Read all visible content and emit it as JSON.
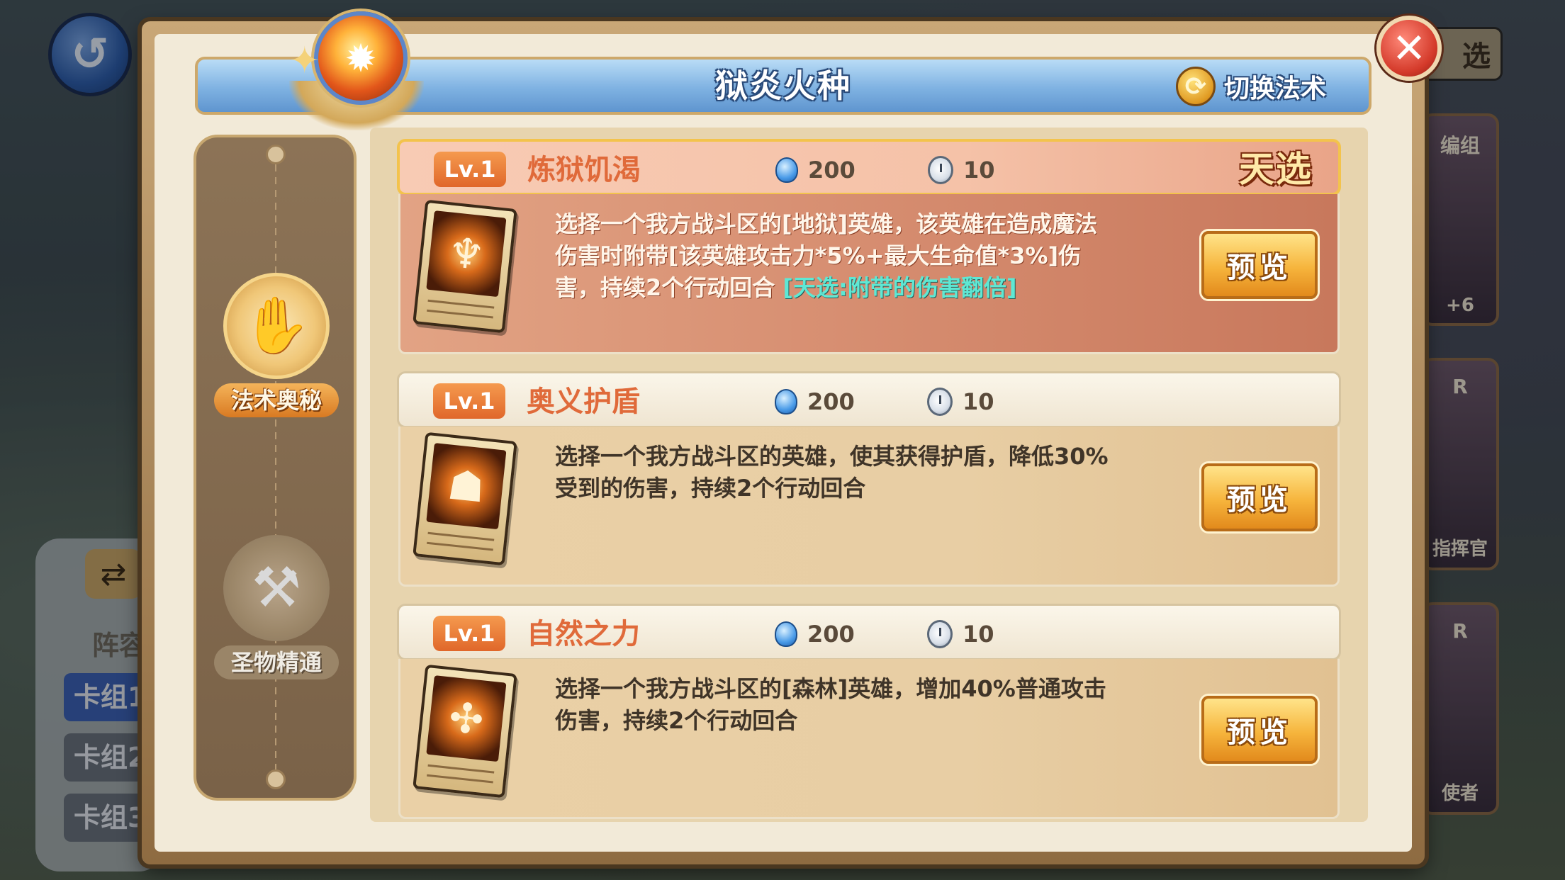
{
  "dialog": {
    "title": "狱炎火种",
    "switch_label": "切换法术"
  },
  "side_tabs": [
    {
      "label": "法术奥秘",
      "active": true,
      "icon": "spell-scroll-icon"
    },
    {
      "label": "圣物精通",
      "active": false,
      "icon": "crossed-hammers-icon"
    }
  ],
  "spells": [
    {
      "level": "Lv.1",
      "name": "炼狱饥渴",
      "cost": "200",
      "turns": "10",
      "tag": "天选",
      "desc": "选择一个我方战斗区的[地狱]英雄，该英雄在造成魔法伤害时附带[该英雄攻击力*5%+最大生命值*3%]伤害，持续2个行动回合",
      "desc_highlight": "[天选:附带的伤害翻倍]",
      "preview_label": "预览",
      "art_glyph": "♆"
    },
    {
      "level": "Lv.1",
      "name": "奥义护盾",
      "cost": "200",
      "turns": "10",
      "desc": "选择一个我方战斗区的英雄，使其获得护盾，降低30%受到的伤害，持续2个行动回合",
      "preview_label": "预览",
      "art_glyph": "☗"
    },
    {
      "level": "Lv.1",
      "name": "自然之力",
      "cost": "200",
      "turns": "10",
      "desc": "选择一个我方战斗区的[森林]英雄，增加40%普通攻击伤害，持续2个行动回合",
      "preview_label": "预览",
      "art_glyph": "✣"
    }
  ],
  "background": {
    "left_label": "阵容",
    "tabs": [
      "卡组1",
      "卡组2",
      "卡组3"
    ],
    "select_label": "选",
    "card_captions": [
      "+6",
      "指挥官",
      "使者"
    ],
    "card_tags": [
      "编组",
      "R",
      "R"
    ]
  },
  "colors": {
    "accent_orange": "#e06a3a",
    "highlight_cyan": "#5ee8d4",
    "title_blue": "#7fb2e2"
  }
}
